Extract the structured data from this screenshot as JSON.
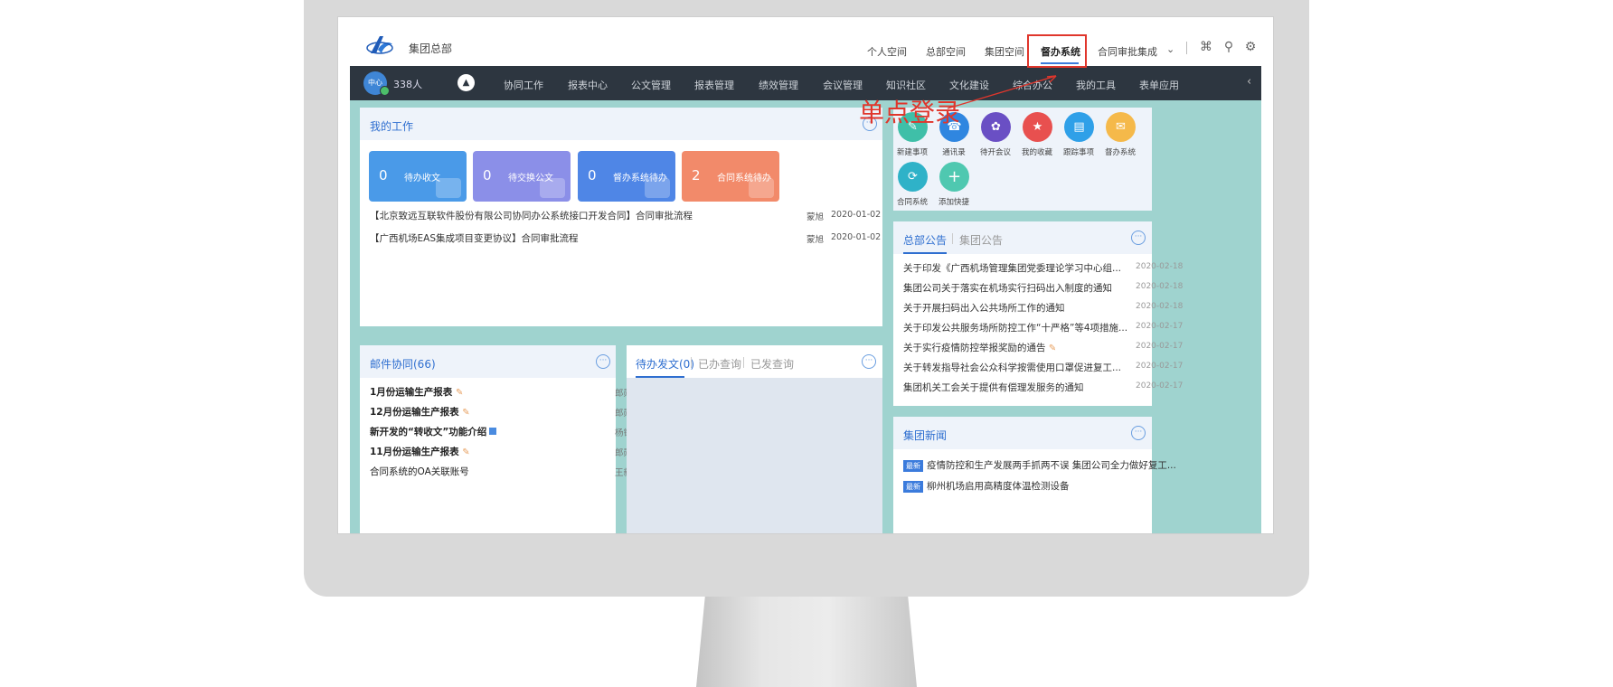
{
  "header": {
    "org_name": "集团总部",
    "nav": [
      "个人空间",
      "总部空间",
      "集团空间",
      "督办系统",
      "合同审批集成"
    ],
    "active_nav": "督办系统"
  },
  "navbar": {
    "avatar_text": "中心",
    "people_count": "338人",
    "items": [
      "协同工作",
      "报表中心",
      "公文管理",
      "报表管理",
      "绩效管理",
      "会议管理",
      "知识社区",
      "文化建设",
      "综合办公",
      "我的工具",
      "表单应用"
    ]
  },
  "annotation": {
    "label": "单点登录",
    "color": "#e0362c"
  },
  "my_work": {
    "title": "我的工作",
    "tiles": [
      {
        "count": "0",
        "label": "待办收文",
        "color": "#4a9ae8"
      },
      {
        "count": "0",
        "label": "待交换公文",
        "color": "#8b8fe8"
      },
      {
        "count": "0",
        "label": "督办系统待办",
        "color": "#4f86e6"
      },
      {
        "count": "2",
        "label": "合同系统待办",
        "color": "#f28a6a"
      }
    ],
    "rows": [
      {
        "text": "【北京致远互联软件股份有限公司协同办公系统接口开发合同】合同审批流程",
        "who": "蒙旭",
        "date": "2020-01-02"
      },
      {
        "text": "【广西机场EAS集成项目变更协议】合同审批流程",
        "who": "蒙旭",
        "date": "2020-01-02"
      }
    ]
  },
  "mail": {
    "title": "邮件协同(66)",
    "rows": [
      {
        "text": "1月份运输生产报表",
        "who": "郎勋",
        "bold": true,
        "mark": "clip"
      },
      {
        "text": "12月份运输生产报表",
        "who": "郎勋",
        "bold": true,
        "mark": "clip"
      },
      {
        "text": "新开发的“转收文”功能介绍",
        "who": "杨钧",
        "bold": true,
        "mark": "doc"
      },
      {
        "text": "11月份运输生产报表",
        "who": "郎勋",
        "bold": true,
        "mark": "clip"
      },
      {
        "text": "合同系统的OA关联账号",
        "who": "王新伟",
        "bold": false,
        "mark": ""
      }
    ]
  },
  "docs": {
    "tabs": [
      "待办发文(0)",
      "已办查询",
      "已发查询"
    ]
  },
  "quick": {
    "items": [
      {
        "label": "新建事项",
        "color": "#3fbfa8",
        "icon": "✎"
      },
      {
        "label": "通讯录",
        "color": "#2f86e0",
        "icon": "☎"
      },
      {
        "label": "待开会议",
        "color": "#6a4fc4",
        "icon": "✿"
      },
      {
        "label": "我的收藏",
        "color": "#e8504f",
        "icon": "★"
      },
      {
        "label": "跟踪事项",
        "color": "#2fa0e8",
        "icon": "▤"
      },
      {
        "label": "督办系统",
        "color": "#f5b94a",
        "icon": "✉"
      },
      {
        "label": "合同系统",
        "color": "#2fb2c8",
        "icon": "⟳"
      },
      {
        "label": "添加快捷",
        "color": "#4fc8b0",
        "icon": "+"
      }
    ]
  },
  "announcements": {
    "tabs": [
      "总部公告",
      "集团公告"
    ],
    "rows": [
      {
        "text": "关于印发《广西机场管理集团党委理论学习中心组...",
        "date": "2020-02-18"
      },
      {
        "text": "集团公司关于落实在机场实行扫码出入制度的通知",
        "date": "2020-02-18"
      },
      {
        "text": "关于开展扫码出入公共场所工作的通知",
        "date": "2020-02-18"
      },
      {
        "text": "关于印发公共服务场所防控工作“十严格”等4项措施...",
        "date": "2020-02-17"
      },
      {
        "text": "关于实行疫情防控举报奖励的通告",
        "date": "2020-02-17"
      },
      {
        "text": "关于转发指导社会公众科学按需使用口罩促进复工...",
        "date": "2020-02-17"
      },
      {
        "text": "集团机关工会关于提供有偿理发服务的通知",
        "date": "2020-02-17"
      }
    ]
  },
  "news": {
    "title": "集团新闻",
    "tag": "最新",
    "rows": [
      "疫情防控和生产发展两手抓两不误 集团公司全力做好复工...",
      "柳州机场启用高精度体温检测设备"
    ]
  }
}
